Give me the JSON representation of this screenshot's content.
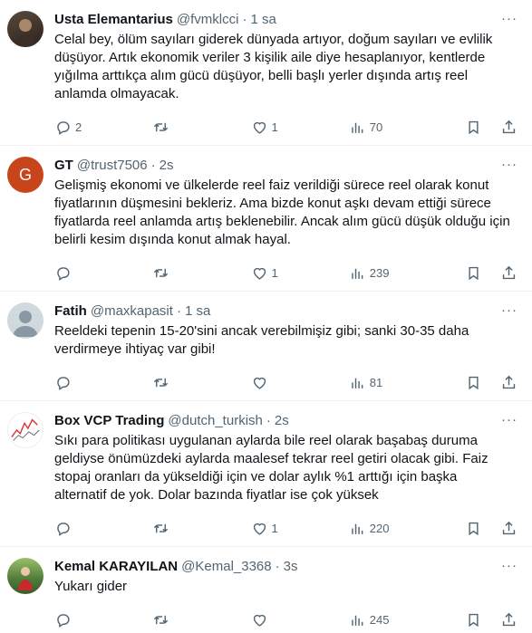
{
  "tweets": [
    {
      "avatar_kind": "photo-dark",
      "name": "Usta Elemantarius",
      "handle": "@fvmklcci",
      "time": "1 sa",
      "text": "Celal bey, ölüm sayıları giderek dünyada artıyor, doğum sayıları ve evlilik düşüyor. Artık ekonomik veriler 3 kişilik aile diye hesaplanıyor, kentlerde yığılma arttıkça alım gücü düşüyor, belli başlı yerler dışında artış reel anlamda olmayacak.",
      "replies": "2",
      "retweets": "",
      "likes": "1",
      "views": "70"
    },
    {
      "avatar_kind": "letter",
      "avatar_letter": "G",
      "avatar_color": "#c8451b",
      "name": "GT",
      "handle": "@trust7506",
      "time": "2s",
      "text": "Gelişmiş ekonomi ve ülkelerde reel faiz verildiği sürece reel olarak konut fiyatlarının düşmesini bekleriz. Ama bizde konut aşkı devam ettiği sürece fiyatlarda reel anlamda artış beklenebilir. Ancak alım gücü düşük olduğu için belirli kesim dışında konut almak hayal.",
      "replies": "",
      "retweets": "",
      "likes": "1",
      "views": "239"
    },
    {
      "avatar_kind": "default",
      "name": "Fatih",
      "handle": "@maxkapasit",
      "time": "1 sa",
      "text": "Reeldeki tepenin 15-20'sini ancak verebilmişiz gibi; sanki 30-35 daha verdirmeye ihtiyaç var gibi!",
      "replies": "",
      "retweets": "",
      "likes": "",
      "views": "81"
    },
    {
      "avatar_kind": "chart",
      "name": "Box VCP Trading",
      "handle": "@dutch_turkish",
      "time": "2s",
      "text": "Sıkı para politikası uygulanan aylarda bile reel olarak başabaş duruma geldiyse önümüzdeki aylarda maalesef tekrar reel getiri olacak gibi. Faiz stopaj oranları da yükseldiği için ve dolar aylık %1 arttığı için başka alternatif de yok. Dolar bazında fiyatlar ise çok yüksek",
      "replies": "",
      "retweets": "",
      "likes": "1",
      "views": "220"
    },
    {
      "avatar_kind": "photo-green",
      "name": "Kemal KARAYILAN",
      "handle": "@Kemal_3368",
      "time": "3s",
      "text": "Yukarı gider",
      "replies": "",
      "retweets": "",
      "likes": "",
      "views": "245"
    }
  ],
  "separator": "·",
  "more_label": "···",
  "colors": {
    "text": "#0f1419",
    "muted": "#536471",
    "border": "#eff3f4"
  }
}
